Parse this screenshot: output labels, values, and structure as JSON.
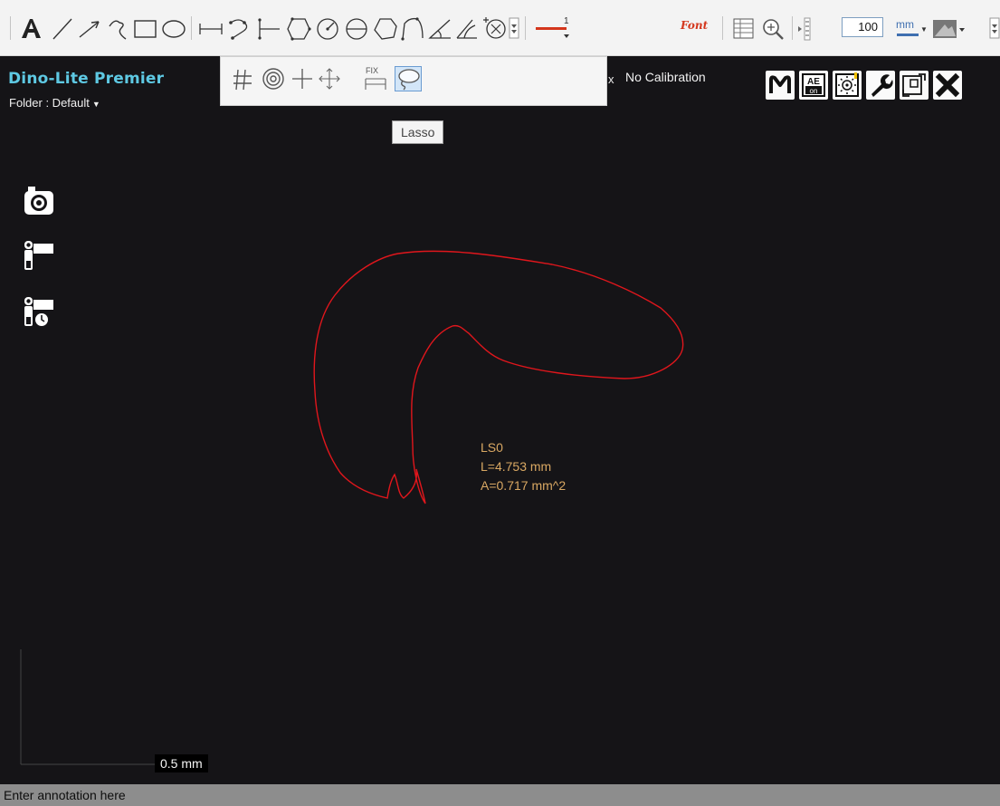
{
  "toolbar": {
    "zoom_value": "100",
    "unit": "mm",
    "font_label": "Font",
    "line_width_label": "1",
    "tools": [
      "text-tool",
      "line-tool",
      "arrow-tool",
      "polyline-tool",
      "rectangle-tool",
      "ellipse-tool",
      "measure-line-tool",
      "measure-polyline-tool",
      "measure-parallel-tool",
      "polygon-measure-tool",
      "circle-measure-tool",
      "circle-diameter-tool",
      "polygon-tool",
      "curve-tool",
      "angle-tool",
      "angle2-tool",
      "circle-center-tool"
    ],
    "accent_color": "#d4361c"
  },
  "viewer": {
    "app_title": "Dino-Lite Premier",
    "folder_label": "Folder : Default",
    "calibration_prefix": "x",
    "calibration_label": "No Calibration",
    "right_buttons": [
      "measurement-mode-button",
      "auto-exposure-button",
      "lighting-button",
      "settings-button",
      "fullscreen-button",
      "close-button"
    ],
    "ae_top": "AE",
    "ae_bottom": "on",
    "m_label": "M"
  },
  "popup_toolbar": {
    "items": [
      "grid-icon",
      "concentric-circles-icon",
      "crosshair-icon",
      "move-icon",
      "fixed-measure-icon",
      "lasso-icon"
    ],
    "fix_label": "FIX",
    "active": "lasso"
  },
  "tooltip": {
    "text": "Lasso"
  },
  "side_toolbar": [
    "camera-icon",
    "video-camera-icon",
    "timer-video-icon"
  ],
  "measurement": {
    "name": "LS0",
    "length": "L=4.753 mm",
    "area": "A=0.717 mm^2",
    "stroke_color": "#e0161c",
    "label_color": "#d9a863"
  },
  "scale_bar": {
    "label": "0.5 mm"
  },
  "status_bar": {
    "annotation_placeholder": "Enter annotation here"
  }
}
